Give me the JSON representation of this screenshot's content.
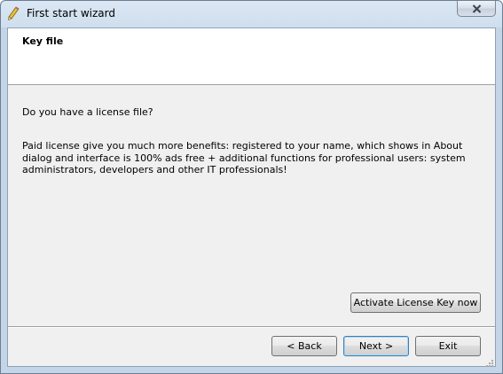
{
  "window": {
    "title": "First start wizard",
    "icon": "pencil-icon"
  },
  "header": {
    "title": "Key file"
  },
  "content": {
    "question": "Do you have a license file?",
    "description": "Paid license give you much more benefits:  registered to your name, which shows in About dialog and interface is 100% ads free + additional functions for professional users: system administrators, developers and other IT professionals!"
  },
  "buttons": {
    "activate": "Activate License Key now",
    "back": "< Back",
    "next": "Next >",
    "exit": "Exit"
  },
  "colors": {
    "panel_background": "#f0f0f0",
    "header_background": "#ffffff",
    "titlebar": "#cfdeee"
  }
}
